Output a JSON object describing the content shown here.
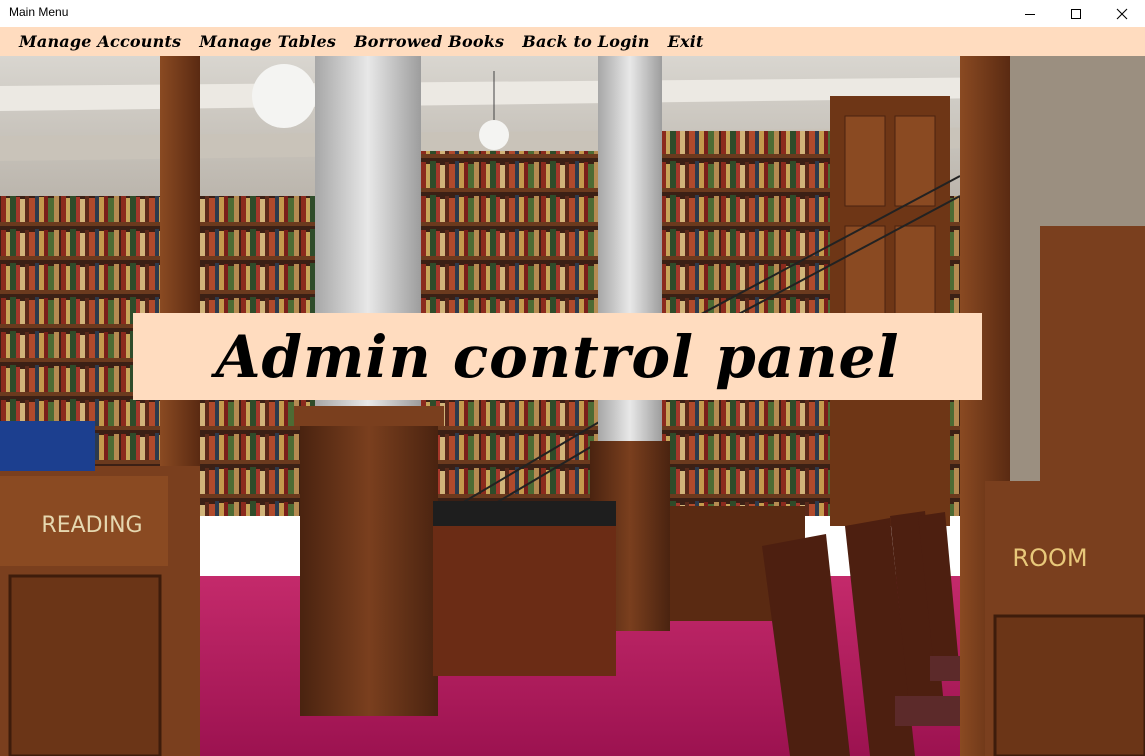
{
  "window": {
    "title": "Main Menu"
  },
  "menu": {
    "items": [
      {
        "label": "Manage Accounts"
      },
      {
        "label": "Manage Tables"
      },
      {
        "label": "Borrowed Books"
      },
      {
        "label": "Back to Login"
      },
      {
        "label": "Exit"
      }
    ]
  },
  "banner": {
    "text": "Admin control panel"
  },
  "scene": {
    "signs": {
      "left": "READING",
      "right": "ROOM"
    }
  },
  "colors": {
    "menu_background": "#ffdcbf",
    "banner_background": "#ffdcbf",
    "carpet": "#b0195a",
    "wood": "#6b3517"
  }
}
